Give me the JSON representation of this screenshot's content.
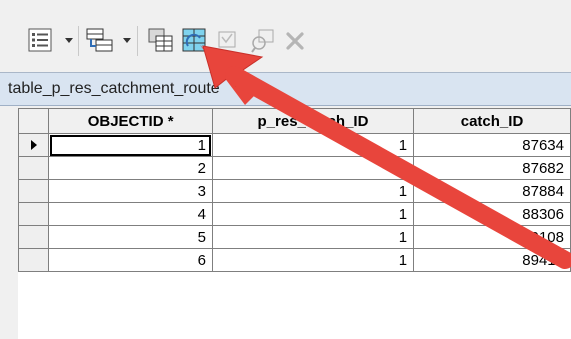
{
  "window": {
    "table_tab_label": "table_p_res_catchment_route"
  },
  "toolbar": {
    "items": [
      {
        "name": "table-options-icon",
        "has_dropdown": true
      },
      {
        "name": "related-tables-icon",
        "has_dropdown": true
      },
      {
        "name": "select-by-attributes-icon",
        "has_dropdown": false
      },
      {
        "name": "switch-selection-icon",
        "has_dropdown": false
      },
      {
        "name": "clear-selection-icon",
        "has_dropdown": false
      },
      {
        "name": "zoom-to-selected-icon",
        "has_dropdown": false
      },
      {
        "name": "delete-selected-icon",
        "has_dropdown": false
      }
    ]
  },
  "grid": {
    "columns": [
      "OBJECTID *",
      "p_res_catch_ID",
      "catch_ID"
    ],
    "rows": [
      [
        "1",
        "1",
        "87634"
      ],
      [
        "2",
        "1",
        "87682"
      ],
      [
        "3",
        "1",
        "87884"
      ],
      [
        "4",
        "1",
        "88306"
      ],
      [
        "5",
        "1",
        "89108"
      ],
      [
        "6",
        "1",
        "89418"
      ]
    ],
    "current_row": 0
  },
  "colors": {
    "annotation_arrow": "#e8453c",
    "tab_background": "#d9e4f1",
    "icon_blue": "#2f6db5"
  }
}
